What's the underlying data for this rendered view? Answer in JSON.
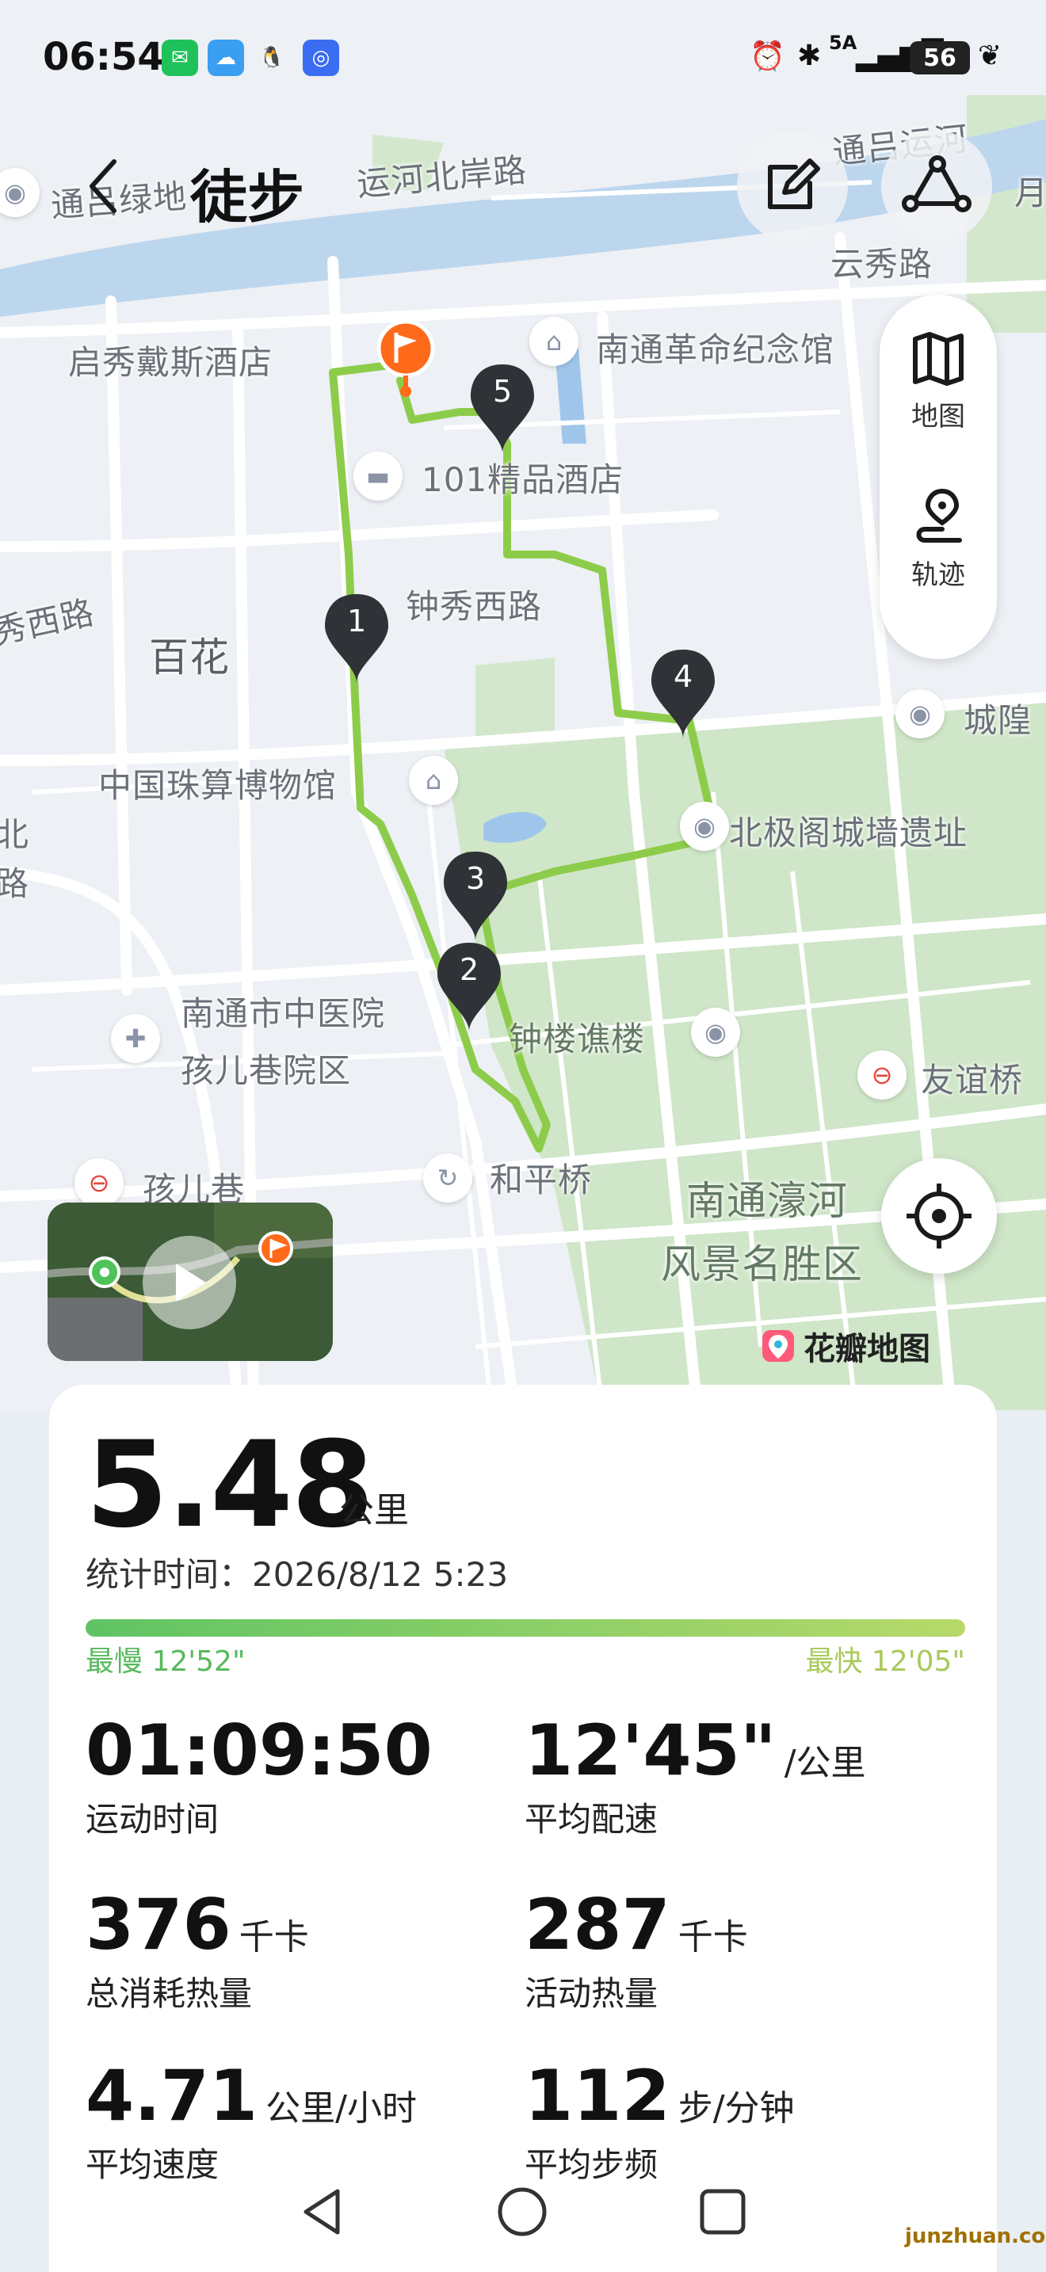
{
  "status_bar": {
    "time": "06:54",
    "network": "5A",
    "battery": "56"
  },
  "header": {
    "back_icon": "chevron-left-icon",
    "title": "徒步",
    "edit_icon": "edit-icon",
    "share_icon": "share-route-icon"
  },
  "map": {
    "labels": [
      "通吕运河",
      "运河北岸路",
      "通吕绿地",
      "云秀路",
      "启秀戴斯酒店",
      "南通革命纪念馆",
      "101精品酒店",
      "百花",
      "钟秀西路",
      "秀西路",
      "城隍",
      "中国珠算博物馆",
      "北极阁城墙遗址",
      "南通市中医院",
      "孩儿巷院区",
      "钟楼谯楼",
      "友谊桥",
      "孩儿巷",
      "和平桥",
      "南通濠河",
      "风景名胜区",
      "月",
      "北",
      "路"
    ],
    "markers": [
      "1",
      "2",
      "3",
      "4",
      "5"
    ]
  },
  "side_menu": {
    "map_label": "地图",
    "track_label": "轨迹"
  },
  "brand": {
    "name": "花瓣地图"
  },
  "summary": {
    "distance": "5.48",
    "distance_unit": "公里",
    "stat_time_label": "统计时间：",
    "stat_time": "2026/8/12 5:23",
    "pace_slowest": "最慢 12'52\"",
    "pace_fastest": "最快 12'05\""
  },
  "metrics": [
    {
      "value": "01:09:50",
      "unit": "",
      "label": "运动时间"
    },
    {
      "value": "12'45\"",
      "unit": "/公里",
      "label": "平均配速"
    },
    {
      "value": "376",
      "unit": "千卡",
      "label": "总消耗热量"
    },
    {
      "value": "287",
      "unit": "千卡",
      "label": "活动热量"
    },
    {
      "value": "4.71",
      "unit": "公里/小时",
      "label": "平均速度"
    },
    {
      "value": "112",
      "unit": "步/分钟",
      "label": "平均步频"
    }
  ],
  "watermark": "junzhuan.com",
  "colors": {
    "route": "#8dcc4a",
    "start": "#ff6a1a",
    "park": "#cfe6c8",
    "river": "#bcd6ee"
  }
}
